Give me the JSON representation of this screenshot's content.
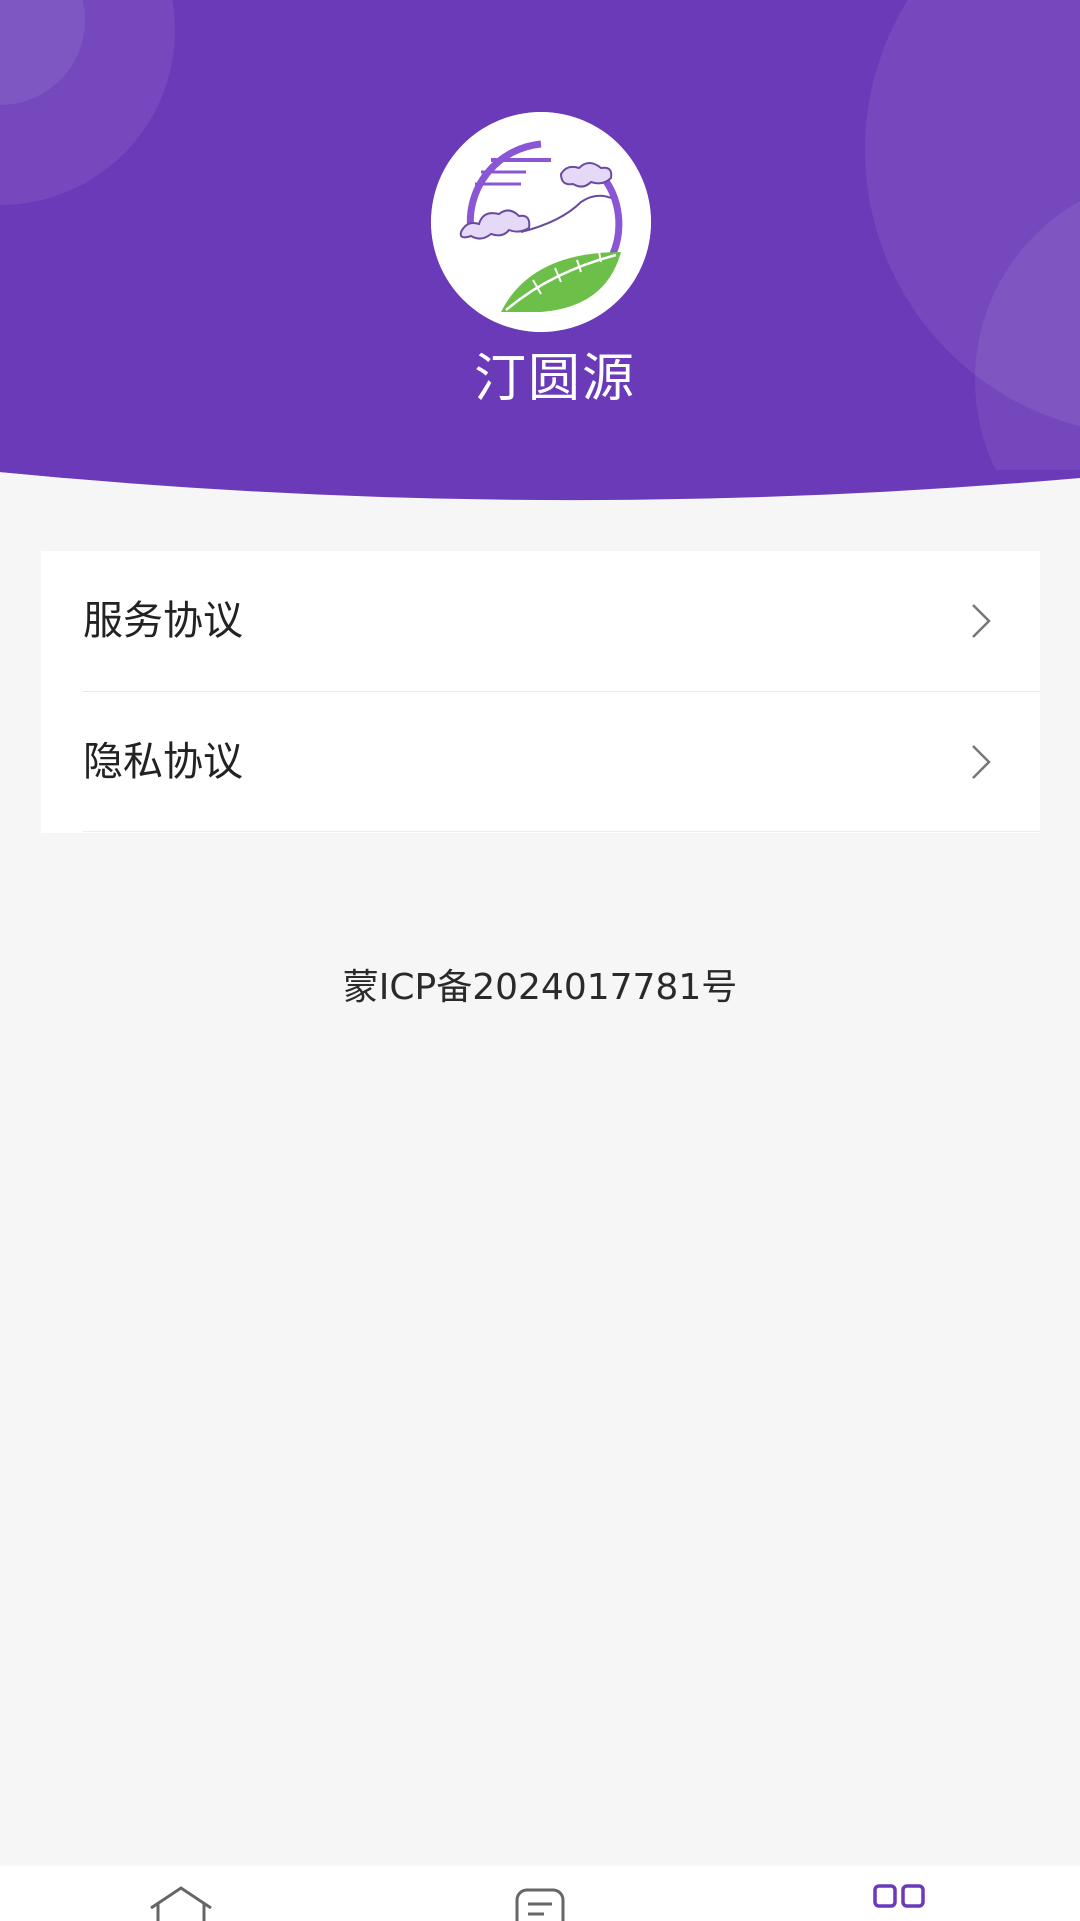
{
  "header": {
    "app_name": "汀圆源",
    "logo_icon": "tea-leaf-cloud-logo",
    "background_color": "#6a3ab8"
  },
  "menu": {
    "items": [
      {
        "label": "服务协议",
        "icon": "chevron-right-icon"
      },
      {
        "label": "隐私协议",
        "icon": "chevron-right-icon"
      }
    ]
  },
  "footer": {
    "icp": "蒙ICP备2024017781号"
  },
  "tabbar": {
    "tabs": [
      {
        "icon": "home-icon",
        "active": false
      },
      {
        "icon": "orders-icon",
        "active": false
      },
      {
        "icon": "mine-icon",
        "active": true
      }
    ],
    "active_color": "#6a3ab8",
    "inactive_color": "#666666"
  }
}
